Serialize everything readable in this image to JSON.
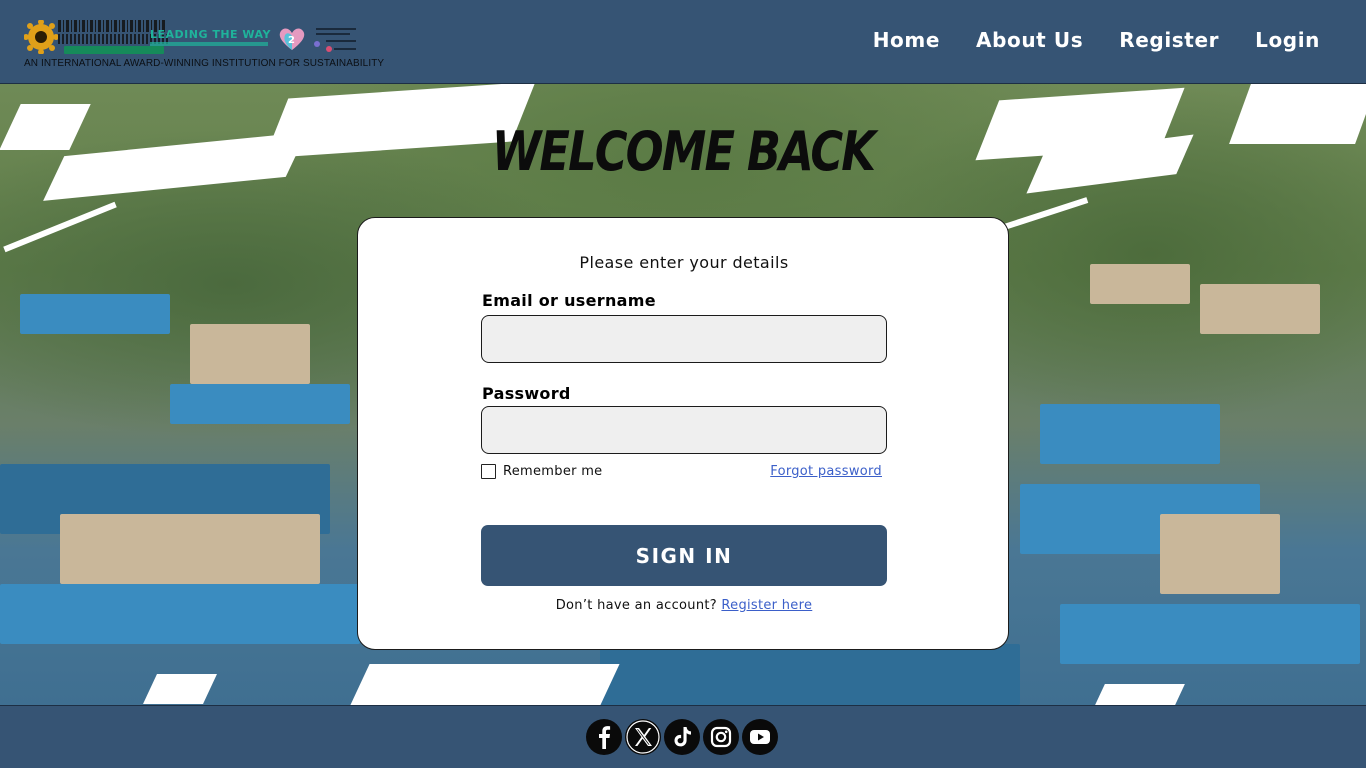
{
  "header": {
    "logo_text": "LEADING THE WAY",
    "tagline": "AN INTERNATIONAL AWARD-WINNING INSTITUTION FOR SUSTAINABILITY",
    "nav": [
      {
        "label": "Home"
      },
      {
        "label": "About Us"
      },
      {
        "label": "Register"
      },
      {
        "label": "Login"
      }
    ]
  },
  "hero": {
    "title": "WELCOME BACK"
  },
  "login": {
    "subtitle": "Please enter your details",
    "email_label": "Email or username",
    "email_value": "",
    "password_label": "Password",
    "password_value": "",
    "remember_label": "Remember me",
    "remember_checked": false,
    "forgot_label": "Forgot password",
    "signin_label": "SIGN IN",
    "register_prompt": "Don’t have an account?",
    "register_link": "Register here"
  },
  "footer": {
    "socials": [
      "facebook-icon",
      "x-icon",
      "tiktok-icon",
      "instagram-icon",
      "youtube-icon"
    ]
  },
  "colors": {
    "primary": "#365474",
    "link": "#3b5fc9",
    "field_bg": "#efefef"
  }
}
